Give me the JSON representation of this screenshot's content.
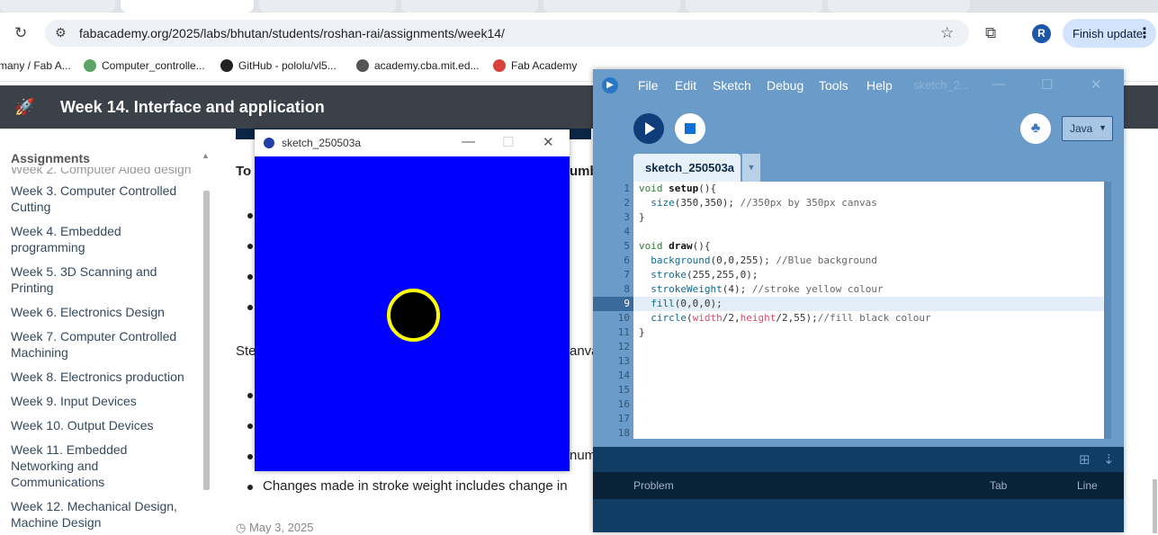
{
  "browser": {
    "url": "fabacademy.org/2025/labs/bhutan/students/roshan-rai/assignments/week14/",
    "avatar_letter": "R",
    "finish_update": "Finish update",
    "bookmarks": [
      {
        "label": "many / Fab A...",
        "icon": "bookmark-icon"
      },
      {
        "label": "Computer_controlle...",
        "icon": "globe-icon"
      },
      {
        "label": "GitHub - pololu/vl5...",
        "icon": "github-icon"
      },
      {
        "label": "academy.cba.mit.ed...",
        "icon": "globe-icon"
      },
      {
        "label": "Fab Academy",
        "icon": "fab-icon"
      }
    ]
  },
  "site": {
    "header_title": "Week 14. Interface and application",
    "sidebar": {
      "heading": "Assignments",
      "cut_item": "Week 2. Computer Aided design",
      "items": [
        "Week 3. Computer Controlled Cutting",
        "Week 4. Embedded programming",
        "Week 5. 3D Scanning and Printing",
        "Week 6. Electronics Design",
        "Week 7. Computer Controlled Machining",
        "Week 8. Electronics production",
        "Week 9. Input Devices",
        "Week 10. Output Devices",
        "Week 11. Embedded Networking and Communications",
        "Week 12. Mechanical Design, Machine Design"
      ]
    },
    "main": {
      "frag_to": "To",
      "frag_umb": "umb",
      "frag_ste": "Ste",
      "frag_anva": "anva",
      "frag_num": "num",
      "last_bullet": "Changes made in stroke weight includes change in",
      "date": "May 3, 2025"
    }
  },
  "sketch_window": {
    "title": "sketch_250503a",
    "canvas_colors": {
      "background": "#0000ff",
      "stroke": "#ffff00",
      "fill": "#000000"
    }
  },
  "ide": {
    "menu": [
      "File",
      "Edit",
      "Sketch",
      "Debug",
      "Tools",
      "Help"
    ],
    "ghost_title": "sketch_2...",
    "mode": "Java",
    "tab_label": "sketch_250503a",
    "line_numbers": [
      "1",
      "2",
      "3",
      "4",
      "5",
      "6",
      "7",
      "8",
      "9",
      "10",
      "11",
      "12",
      "13",
      "14",
      "15",
      "16",
      "17",
      "18"
    ],
    "code": {
      "l1_kw": "void",
      "l1_fn": "setup",
      "l1_rest": "(){",
      "l2_fn": "size",
      "l2_args": "(350,350);",
      "l2_cm": "//350px by 350px canvas",
      "l3": "}",
      "l5_kw": "void",
      "l5_fn": "draw",
      "l5_rest": "(){",
      "l6_fn": "background",
      "l6_args": "(0,0,255);",
      "l6_cm": "//Blue background",
      "l7_fn": "stroke",
      "l7_args": "(255,255,0);",
      "l8_fn": "strokeWeight",
      "l8_args": "(4);",
      "l8_cm": "//stroke yellow colour",
      "l9_fn": "fill",
      "l9_args": "(0,0,0);",
      "l10_fn": "circle",
      "l10_p1": "(",
      "l10_w": "width",
      "l10_p2": "/2,",
      "l10_h": "height",
      "l10_p3": "/2,55);",
      "l10_cm": "//fill black colour",
      "l11": "}"
    },
    "problems": {
      "problem": "Problem",
      "tab": "Tab",
      "line": "Line"
    }
  }
}
